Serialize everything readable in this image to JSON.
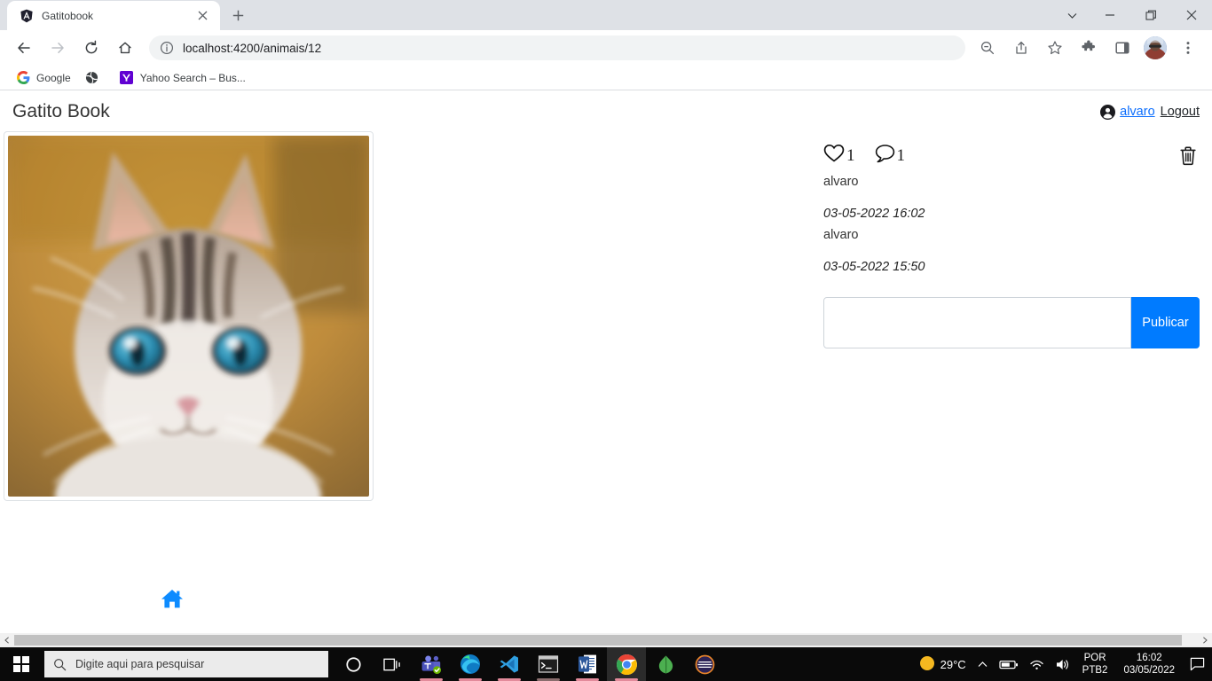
{
  "browser": {
    "tab": {
      "title": "Gatitobook",
      "favicon": "angular-favicon",
      "close_icon": "close-icon"
    },
    "new_tab_icon": "plus-icon",
    "window_controls": {
      "tab_search_icon": "chevron-down-icon",
      "minimize_icon": "minimize-icon",
      "maximize_icon": "maximize-icon",
      "close_icon": "close-icon"
    },
    "toolbar": {
      "back_icon": "back-arrow-icon",
      "forward_icon": "forward-arrow-icon",
      "reload_icon": "reload-icon",
      "home_icon": "home-icon",
      "omnibox": {
        "info_icon": "info-circle-icon",
        "url": "localhost:4200/animais/12"
      },
      "zoom_icon": "zoom-out-icon",
      "share_icon": "share-icon",
      "bookmark_icon": "star-icon",
      "extensions_icon": "puzzle-piece-icon",
      "sidepanel_icon": "side-panel-icon",
      "profile_icon": "profile-avatar",
      "menu_icon": "three-dot-menu-icon"
    },
    "bookmarks": [
      {
        "label": "Google",
        "icon": "google-g-icon"
      },
      {
        "label": "",
        "icon": "globe-icon"
      },
      {
        "label": "Yahoo Search – Bus...",
        "icon": "yahoo-y-icon"
      }
    ]
  },
  "page": {
    "brand": "Gatito Book",
    "user": {
      "icon": "person-circle-icon",
      "name": "alvaro",
      "logout": "Logout"
    },
    "photo": {
      "alt": "kitten-photo"
    },
    "detail": {
      "like": {
        "icon": "heart-outline-icon",
        "count": "1"
      },
      "comment": {
        "icon": "comment-bubble-icon",
        "count": "1"
      },
      "delete_icon": "trash-icon",
      "comments": [
        {
          "user": "alvaro",
          "date": "03-05-2022 16:02"
        },
        {
          "user": "alvaro",
          "date": "03-05-2022 15:50"
        }
      ],
      "comment_input": {
        "value": "",
        "placeholder": ""
      },
      "publish_button": "Publicar"
    },
    "footer_home_icon": "home-icon",
    "scrollbar": {
      "left_arrow": "scroll-left-arrow",
      "right_arrow": "scroll-right-arrow"
    }
  },
  "taskbar": {
    "start_icon": "windows-start-icon",
    "search": {
      "icon": "search-magnifier-icon",
      "placeholder": "Digite aqui para pesquisar"
    },
    "apps": [
      {
        "name": "cortana-icon",
        "active": false
      },
      {
        "name": "task-view-icon",
        "active": false
      },
      {
        "name": "microsoft-teams-icon",
        "active": true
      },
      {
        "name": "microsoft-edge-icon",
        "active": true
      },
      {
        "name": "vs-code-icon",
        "active": true
      },
      {
        "name": "command-prompt-icon",
        "active": true
      },
      {
        "name": "microsoft-word-icon",
        "active": true
      },
      {
        "name": "google-chrome-icon",
        "active": true
      },
      {
        "name": "mongodb-leaf-icon",
        "active": false
      },
      {
        "name": "eclipse-icon",
        "active": false
      }
    ],
    "tray": {
      "weather_icon": "sun-icon",
      "temperature": "29°C",
      "chevron_icon": "chevron-up-icon",
      "battery_icon": "battery-icon",
      "wifi_icon": "wifi-icon",
      "volume_icon": "speaker-icon",
      "language_line1": "POR",
      "language_line2": "PTB2",
      "time": "16:02",
      "date": "03/05/2022",
      "notification_icon": "notification-icon"
    }
  },
  "colors": {
    "accent_blue": "#007bff",
    "link_blue": "#0d6efd",
    "chrome_frame": "#dee1e6",
    "taskbar": "#0a0a0a"
  }
}
